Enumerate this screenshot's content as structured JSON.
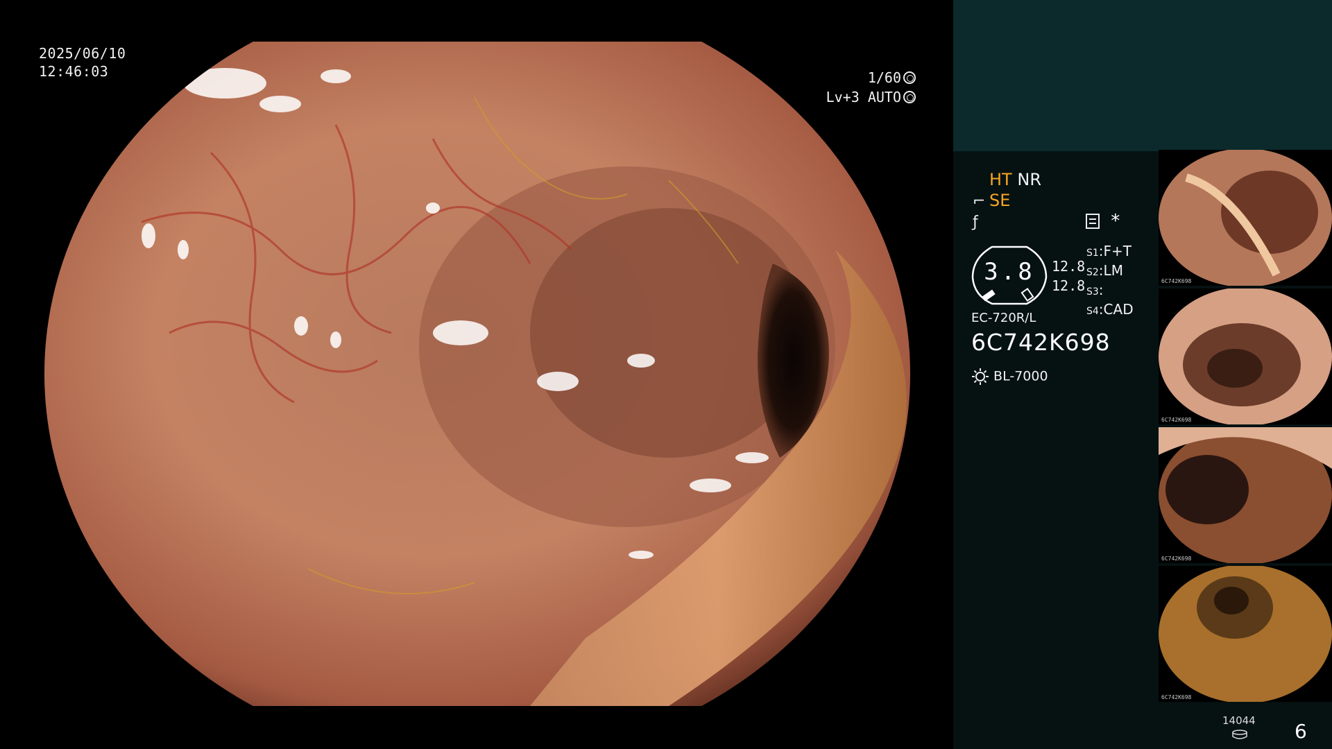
{
  "header": {
    "date": "2025/06/10",
    "time": "12:46:03"
  },
  "exposure": {
    "shutter": "1/60",
    "level": "Lv+3 AUTO",
    "shutter_icon": "aperture-icon",
    "level_icon": "auto-iris-icon"
  },
  "modes": {
    "ht": "HT",
    "nr": "NR",
    "se": "SE",
    "se_icon": "scope-tip-icon",
    "freeze_icon": "slash-f-icon",
    "settings_icon": "settings-list-icon",
    "asterisk": "*"
  },
  "gauge": {
    "value": "3.8",
    "upper": "12.8",
    "lower": "12.8"
  },
  "switches": [
    {
      "key": "S1",
      "value": "F+T"
    },
    {
      "key": "S2",
      "value": "LM"
    },
    {
      "key": "S3",
      "value": ""
    },
    {
      "key": "S4",
      "value": "CAD"
    }
  ],
  "scope": {
    "model": "EC-720R/L",
    "serial": "6C742K698"
  },
  "light_source": {
    "icon": "sun-icon",
    "name": "BL-7000"
  },
  "thumbnails": [
    {
      "label": "6C742K698"
    },
    {
      "label": "6C742K698"
    },
    {
      "label": "6C742K698"
    },
    {
      "label": "6C742K698"
    }
  ],
  "footer": {
    "count": "14044",
    "count_icon": "database-icon",
    "image_number": "6"
  },
  "colors": {
    "accent_orange": "#f5a623",
    "top_panel": "#0c2a2c",
    "side_panel": "#061112"
  }
}
